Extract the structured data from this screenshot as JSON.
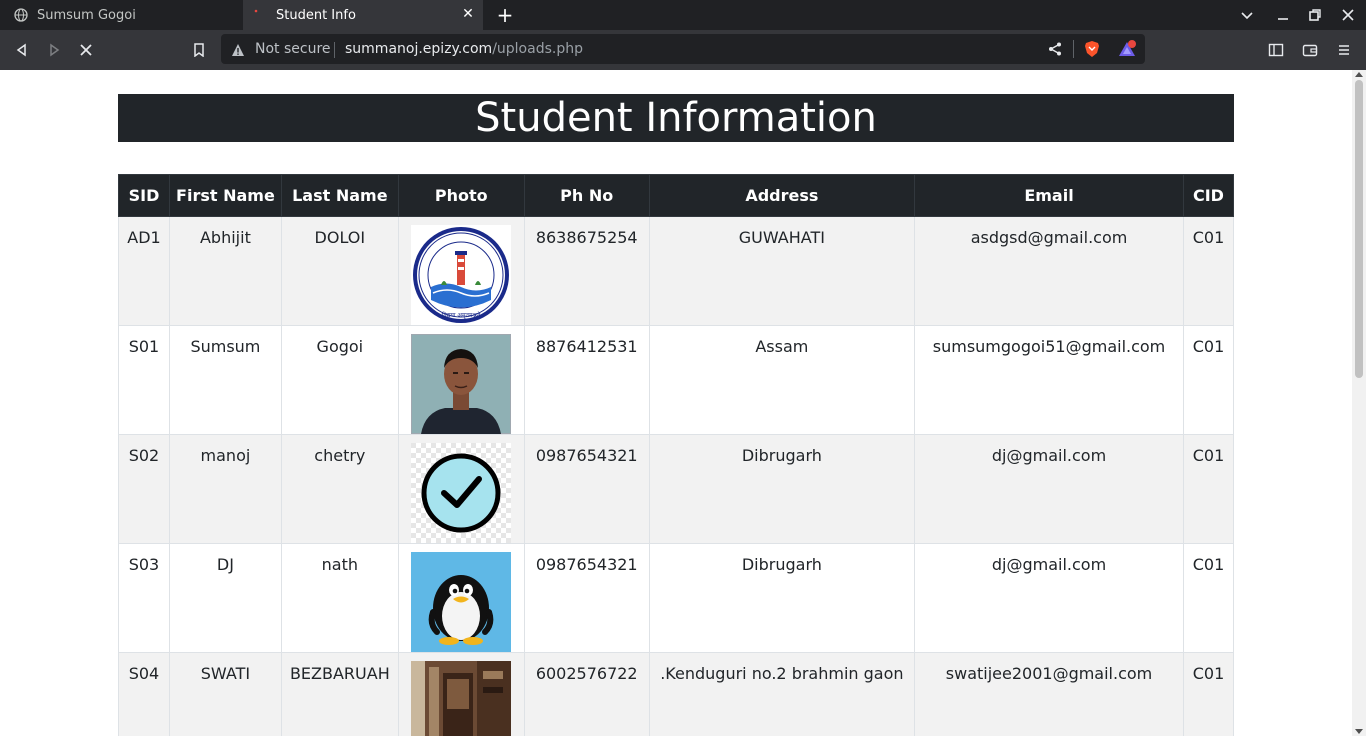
{
  "browser": {
    "tabs": [
      {
        "title": "Sumsum Gogoi",
        "active": false,
        "icon": "globe-icon"
      },
      {
        "title": "Student Info",
        "active": true,
        "icon": "loading-dot-icon"
      }
    ],
    "new_tab_label": "+",
    "security_label": "Not secure",
    "url_host": "summanoj.epizy.com",
    "url_path": "/uploads.php",
    "rewards_badge_color": "#e8473f",
    "brave_color": "#fb542b"
  },
  "page": {
    "title": "Student Information",
    "columns": [
      "SID",
      "First Name",
      "Last Name",
      "Photo",
      "Ph No",
      "Address",
      "Email",
      "CID"
    ],
    "rows": [
      {
        "sid": "AD1",
        "first": "Abhijit",
        "last": "DOLOI",
        "photo": "university-seal-image",
        "phone": "8638675254",
        "address": "GUWAHATI",
        "email": "asdgsd@gmail.com",
        "cid": "C01",
        "seal_text": "DIBRUGARH UNIVERSITY"
      },
      {
        "sid": "S01",
        "first": "Sumsum",
        "last": "Gogoi",
        "photo": "portrait-photo-image",
        "phone": "8876412531",
        "address": "Assam",
        "email": "sumsumgogoi51@gmail.com",
        "cid": "C01"
      },
      {
        "sid": "S02",
        "first": "manoj",
        "last": "chetry",
        "photo": "checkmark-image",
        "phone": "0987654321",
        "address": "Dibrugarh",
        "email": "dj@gmail.com",
        "cid": "C01"
      },
      {
        "sid": "S03",
        "first": "DJ",
        "last": "nath",
        "photo": "penguin-image",
        "phone": "0987654321",
        "address": "Dibrugarh",
        "email": "dj@gmail.com",
        "cid": "C01"
      },
      {
        "sid": "S04",
        "first": "SWATI",
        "last": "BEZBARUAH",
        "photo": "room-photo-image",
        "phone": "6002576722",
        "address": ".Kenduguri no.2 brahmin gaon",
        "email": "swatijee2001@gmail.com",
        "cid": "C01"
      }
    ],
    "header_bg": "#212529",
    "stripe_bg": "#f2f2f2"
  }
}
